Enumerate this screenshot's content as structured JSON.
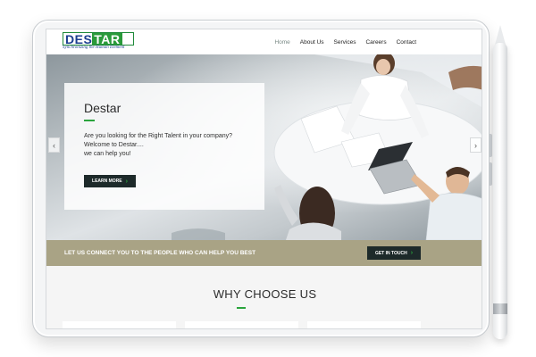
{
  "logo": {
    "name_part1": "DES",
    "name_part2": "TAR",
    "tagline": "Synchronizing the Human Element"
  },
  "nav": {
    "items": [
      {
        "label": "Home",
        "active": true
      },
      {
        "label": "About Us",
        "active": false
      },
      {
        "label": "Services",
        "active": false
      },
      {
        "label": "Careers",
        "active": false
      },
      {
        "label": "Contact",
        "active": false
      }
    ]
  },
  "hero": {
    "title": "Destar",
    "lines": [
      "Are you looking for the Right Talent in your company?",
      "Welcome to Destar....",
      "we can help you!"
    ],
    "button_label": "LEARN MORE",
    "prev_icon": "chevron-left-icon",
    "next_icon": "chevron-right-icon"
  },
  "banner": {
    "text": "LET US CONNECT YOU TO THE PEOPLE WHO CAN HELP YOU BEST",
    "button_label": "GET IN TOUCH"
  },
  "why": {
    "title": "WHY CHOOSE US"
  },
  "colors": {
    "brand_blue": "#1b3f8f",
    "brand_green": "#2a9a3a",
    "accent_green": "#2aa43c",
    "banner_bg": "#a9a385",
    "button_dark": "#1d2a2a"
  }
}
